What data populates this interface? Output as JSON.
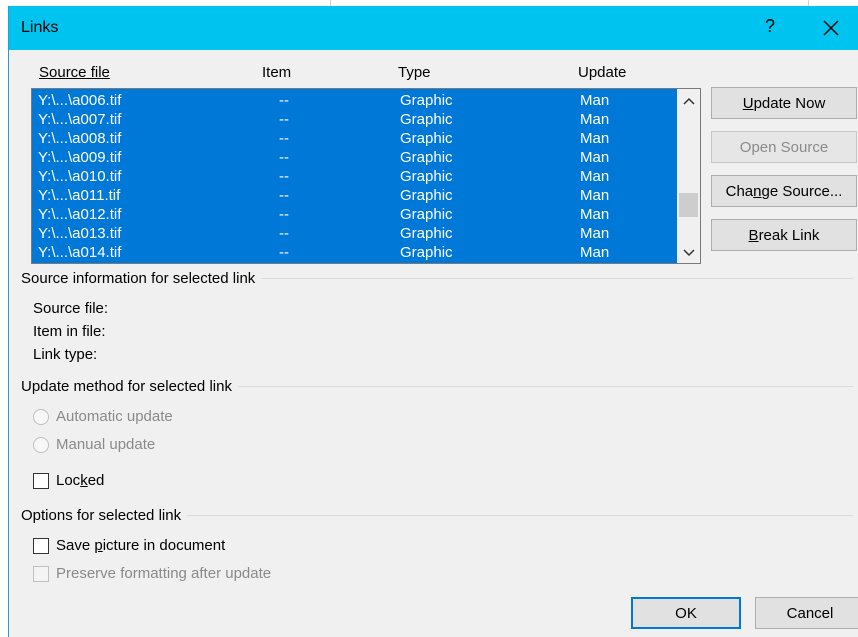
{
  "window": {
    "title": "Links",
    "help_glyph": "?"
  },
  "columns": {
    "source_file": "Source file",
    "item": "Item",
    "type": "Type",
    "update": "Update"
  },
  "links": [
    {
      "source": "Y:\\...\\a006.tif",
      "item": "--",
      "type": "Graphic",
      "update": "Man"
    },
    {
      "source": "Y:\\...\\a007.tif",
      "item": "--",
      "type": "Graphic",
      "update": "Man"
    },
    {
      "source": "Y:\\...\\a008.tif",
      "item": "--",
      "type": "Graphic",
      "update": "Man"
    },
    {
      "source": "Y:\\...\\a009.tif",
      "item": "--",
      "type": "Graphic",
      "update": "Man"
    },
    {
      "source": "Y:\\...\\a010.tif",
      "item": "--",
      "type": "Graphic",
      "update": "Man"
    },
    {
      "source": "Y:\\...\\a011.tif",
      "item": "--",
      "type": "Graphic",
      "update": "Man"
    },
    {
      "source": "Y:\\...\\a012.tif",
      "item": "--",
      "type": "Graphic",
      "update": "Man"
    },
    {
      "source": "Y:\\...\\a013.tif",
      "item": "--",
      "type": "Graphic",
      "update": "Man"
    },
    {
      "source": "Y:\\...\\a014.tif",
      "item": "--",
      "type": "Graphic",
      "update": "Man"
    }
  ],
  "buttons": {
    "update_now_u": "U",
    "update_now_rest": "pdate Now",
    "open_source": "Open Source",
    "change_source_pre": "Cha",
    "change_source_u": "n",
    "change_source_post": "ge Source...",
    "break_link_u": "B",
    "break_link_rest": "reak Link",
    "ok": "OK",
    "cancel": "Cancel"
  },
  "source_info": {
    "heading": "Source information for selected link",
    "source_file": "Source file:",
    "item_in_file": "Item in file:",
    "link_type": "Link type:"
  },
  "update_method": {
    "heading": "Update method for selected link",
    "automatic": "Automatic update",
    "manual": "Manual update",
    "locked_pre": "Loc",
    "locked_u": "k",
    "locked_post": "ed"
  },
  "options": {
    "heading": "Options for selected link",
    "save_pre": "Save ",
    "save_u": "p",
    "save_post": "icture in document",
    "preserve": "Preserve formatting after update"
  },
  "colors": {
    "titlebar": "#00c4f0",
    "selection": "#0078d7",
    "dialog_bg": "#f0f0f0",
    "default_border": "#0078d7"
  }
}
